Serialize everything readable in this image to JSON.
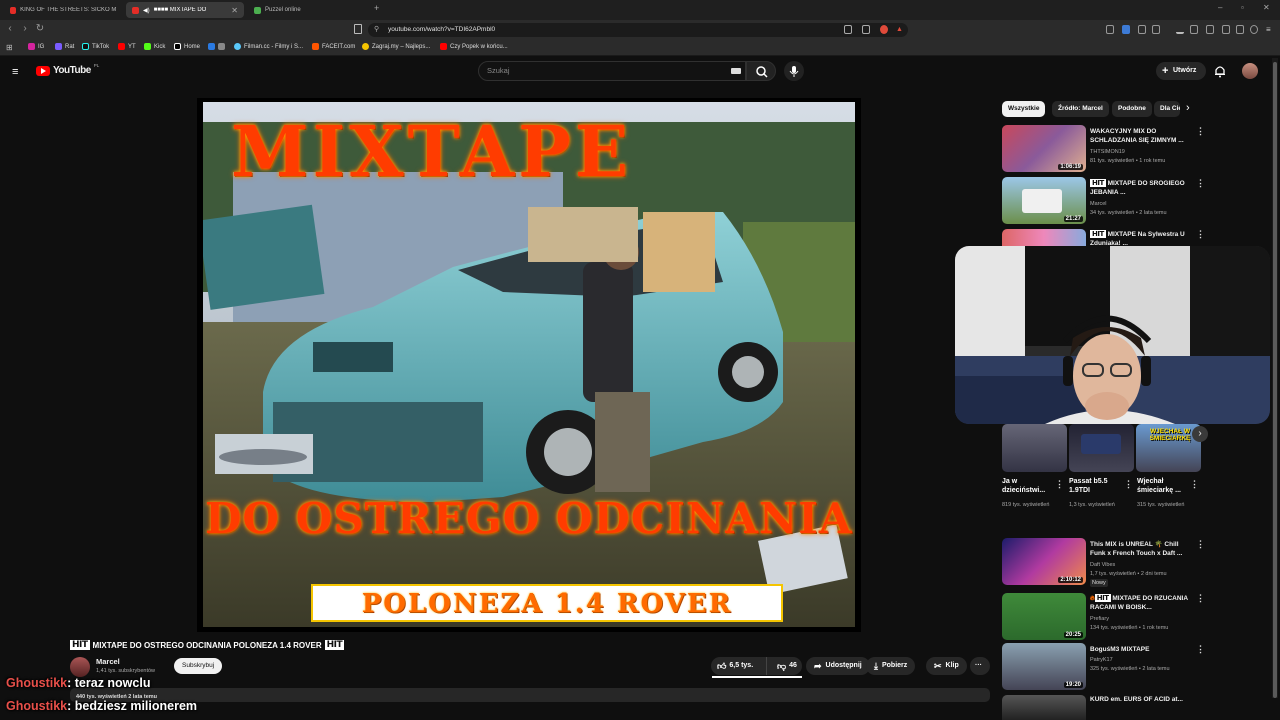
{
  "browser": {
    "tabs": [
      {
        "label": "KING OF THE STREETS: SICKO MODE",
        "active": false
      },
      {
        "label": "■■■■ MIXTAPE DO",
        "active": true
      },
      {
        "label": "Puzzel online",
        "active": false
      }
    ],
    "url": "youtube.com/watch?v=TDI62APmbl0",
    "bookmarks": [
      "IG",
      "Rat",
      "TikTok",
      "YT",
      "Kick",
      "Home",
      "Filman.cc - Filmy i S...",
      "FACEIT.com",
      "Zagraj.my – Najleps...",
      "Czy Popek w końcu..."
    ]
  },
  "youtube": {
    "logo": "YouTube",
    "region": "PL",
    "search_placeholder": "Szukaj",
    "create_label": "Utwórz"
  },
  "video": {
    "thumb_title": "MIXTAPE",
    "thumb_line2": "DO OSTREGO ODCINANIA",
    "thumb_line3": "POLONEZA 1.4 ROVER",
    "hit": "HIT",
    "title": "MIXTAPE DO OSTREGO ODCINANIA POLONEZA 1.4 ROVER",
    "channel": "Marcel",
    "subscribers": "1,41 tys. subskrybentów",
    "subscribe_label": "Subskrybuj",
    "likes": "6,5 tys.",
    "dislikes": "46",
    "share_label": "Udostępnij",
    "download_label": "Pobierz",
    "clip_label": "Klip",
    "views_partial": "440 tys. wyświetleń  2 lata temu"
  },
  "chat": [
    {
      "user": "Ghoustikk",
      "message": ": teraz nowclu"
    },
    {
      "user": "Ghoustikk",
      "message": ": bedziesz milionerem"
    }
  ],
  "sidebar": {
    "chips": [
      "Wszystkie",
      "Źródło: Marcel",
      "Podobne",
      "Dla Ciebie"
    ],
    "videos_top": [
      {
        "title": "WAKACYJNY MIX DO SCHLADZANIA SIĘ ZIMNYM ...",
        "channel": "THTSIMON19",
        "meta": "81 tys. wyświetleń • 1 rok temu",
        "duration": "1:06:19"
      },
      {
        "title": "MIXTAPE DO SROGIEGO JEBANIA ...",
        "channel": "Marcel",
        "meta": "34 tys. wyświetleń • 2 lata temu",
        "duration": "21:27",
        "hit": "HIT"
      },
      {
        "title": "MIXTAPE Na Sylwestra U Zduniaka! ...",
        "channel": "",
        "meta": "",
        "duration": "",
        "hit": "HIT"
      }
    ],
    "shorts": [
      {
        "title": "Ja w dzieciństwi...",
        "meta": "819 tys. wyświetleń"
      },
      {
        "title": "Passat b5.5 1.9TDI",
        "meta": "1,3 tys. wyświetleń"
      },
      {
        "title": "Wjechał śmieciarkę ...",
        "meta": "315 tys. wyświetleń"
      }
    ],
    "short3_overlay": "WJECHAŁ W ŚMIECIARKĘ",
    "videos_bottom": [
      {
        "title": "This MIX is UNREAL 🌴 Chill Funk x French Touch x Daft ...",
        "channel": "Daft Vibes",
        "meta": "1,7 tys. wyświetleń • 2 dni temu",
        "badge": "Nowy",
        "duration": "2:10:12"
      },
      {
        "title": "MIXTAPE DO RZUCANIA RACAMI W BOISK...",
        "channel": "Prefiary",
        "meta": "134 tys. wyświetleń • 1 rok temu",
        "duration": "20:25",
        "hit": "HIT"
      },
      {
        "title": "BoguśM3 MIXTAPE",
        "channel": "PatryK17",
        "meta": "325 tys. wyświetleń • 2 lata temu",
        "duration": "19:20"
      },
      {
        "title": "KURD em. EURS OF ACID at...",
        "channel": "",
        "meta": "",
        "duration": ""
      }
    ]
  },
  "colors": {
    "background": "#0f0f0f",
    "youtube_red": "#ff0000",
    "chat_user": "#e8504a"
  }
}
